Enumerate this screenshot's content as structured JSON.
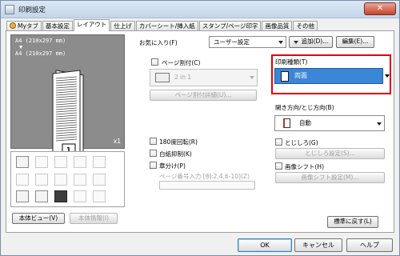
{
  "window": {
    "title": "印刷設定",
    "close_label": "✕"
  },
  "tabs": [
    {
      "label": "Myタブ"
    },
    {
      "label": "基本設定"
    },
    {
      "label": "レイアウト"
    },
    {
      "label": "仕上げ"
    },
    {
      "label": "カバーシート/挿入紙"
    },
    {
      "label": "スタンプ/ページ印字"
    },
    {
      "label": "画像品質"
    },
    {
      "label": "その他"
    }
  ],
  "preview": {
    "paper_line1": "A4 (210x297 mm)",
    "paper_arrow": "▼",
    "paper_line2": "A4 (210x297 mm)",
    "copies": "x1",
    "page_number": "1"
  },
  "left_buttons": {
    "body_view": "本体ビュー(V)",
    "body_info": "本体情報(I)"
  },
  "favorites": {
    "label": "お気に入り(F)",
    "value": "ユーザー設定",
    "add_button": "追加(D)...",
    "edit_button": "編集(E)..."
  },
  "combine": {
    "label": "ページ割付(C)",
    "value": "2 in 1",
    "detail_button": "ページ割付詳細(U)..."
  },
  "rotate": {
    "label": "180度回転(R)"
  },
  "skip_blank": {
    "label": "白紙抑制(K)"
  },
  "chapters": {
    "label": "章分け(P)",
    "hint": "ページ番号入力 [例:2,4,6-10](Z)"
  },
  "print_type": {
    "label": "印刷種類(T)",
    "value": "両面"
  },
  "binding": {
    "label": "開き方向/とじ方向(B)",
    "value": "自動"
  },
  "margin": {
    "label": "とじしろ(G)",
    "settings_button": "とじしろ設定(S)..."
  },
  "image_shift": {
    "label": "画像シフト(H)",
    "settings_button": "画像シフト設定(M)..."
  },
  "defaults_button": "標準に戻す(L)",
  "footer": {
    "ok": "OK",
    "cancel": "キャンセル",
    "help": "ヘルプ"
  }
}
